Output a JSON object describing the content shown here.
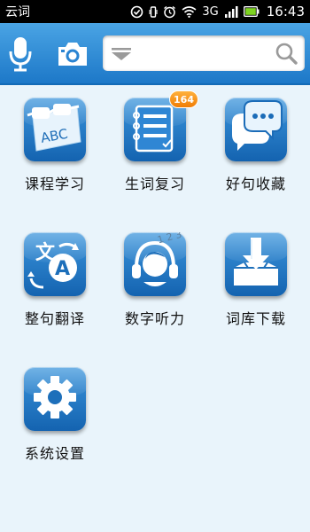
{
  "status_bar": {
    "app_name": "云词",
    "network": "3G",
    "time": "16:43",
    "icons": [
      "check-circle-icon",
      "vibrate-icon",
      "alarm-icon",
      "wifi-icon",
      "signal-icon",
      "battery-icon"
    ]
  },
  "top_bar": {
    "icons": [
      "microphone-icon",
      "camera-icon",
      "dropdown-arrow-icon",
      "search-icon"
    ],
    "search": {
      "value": "",
      "placeholder": ""
    }
  },
  "tiles": [
    {
      "label": "课程学习",
      "icon": "glasses-abc-icon"
    },
    {
      "label": "生词复习",
      "icon": "notebook-list-icon",
      "badge": "164"
    },
    {
      "label": "好句收藏",
      "icon": "speech-bubble-icon"
    },
    {
      "label": "整句翻译",
      "icon": "translate-icon"
    },
    {
      "label": "数字听力",
      "icon": "headphones-icon"
    },
    {
      "label": "词库下载",
      "icon": "download-box-icon"
    },
    {
      "label": "系统设置",
      "icon": "gear-icon"
    }
  ],
  "colors": {
    "top_bar": "#1d78c8",
    "background": "#e9f4fb",
    "tile_base": "#1463b0",
    "badge": "#f07d05"
  }
}
